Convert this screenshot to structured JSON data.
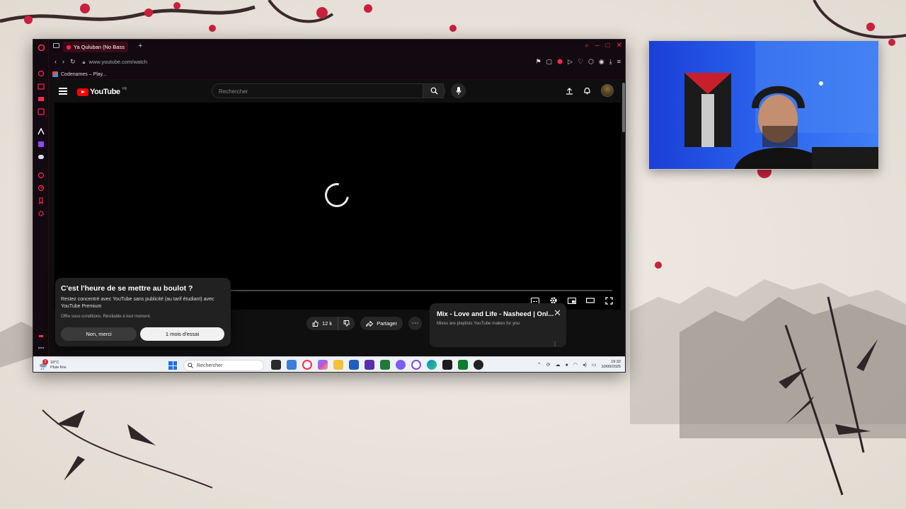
{
  "browser": {
    "tab_title": "Ya Quluban (No Bass",
    "new_tab_glyph": "+",
    "url": "www.youtube.com/watch",
    "bookmark": "Codenames – Play..."
  },
  "youtube": {
    "logo_text": "YouTube",
    "region": "FR",
    "search_placeholder": "Rechercher",
    "like_count": "12 k",
    "share_label": "Partager",
    "mix": {
      "title": "Mix - Love and Life - Nasheed | Onl...",
      "subtitle": "Mixes are playlists YouTube makes for you"
    }
  },
  "promo": {
    "title": "C'est l'heure de se mettre au boulot ?",
    "body": "Restez concentré avec YouTube sans publicité (au tarif étudiant) avec YouTube Premium",
    "fine_print": "Offre sous conditions. Résiliable à tout moment.",
    "decline_label": "Non, merci",
    "accept_label": "1 mois d'essai"
  },
  "taskbar": {
    "weather_temp": "18°C",
    "weather_desc": "Pluie fine",
    "weather_badge": "2",
    "search_label": "Rechercher",
    "time": "19:32",
    "date": "10/09/2025"
  },
  "colors": {
    "opera_accent": "#ff2b4f",
    "youtube_red": "#ff0000",
    "yt_background": "#0f0f0f"
  }
}
